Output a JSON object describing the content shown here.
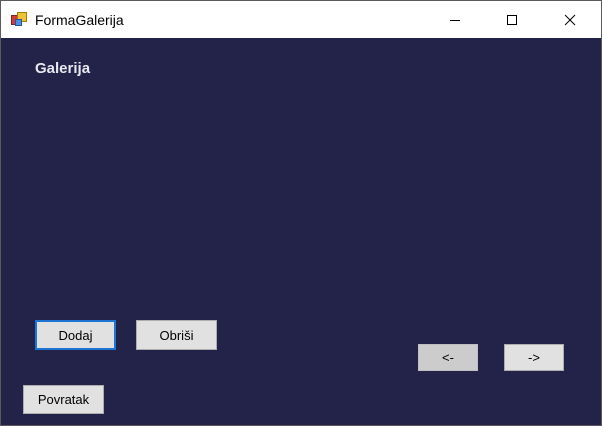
{
  "window": {
    "title": "FormaGalerija"
  },
  "form": {
    "heading": "Galerija"
  },
  "buttons": {
    "add": "Dodaj",
    "delete": "Obriši",
    "prev": "<-",
    "next": "->",
    "back": "Povratak"
  },
  "colors": {
    "background": "#232249",
    "focus_border": "#1e74d2",
    "button_face": "#e1e1e1"
  },
  "icons": {
    "app": "form-app-icon",
    "minimize": "minimize-icon",
    "maximize": "maximize-icon",
    "close": "close-icon"
  }
}
